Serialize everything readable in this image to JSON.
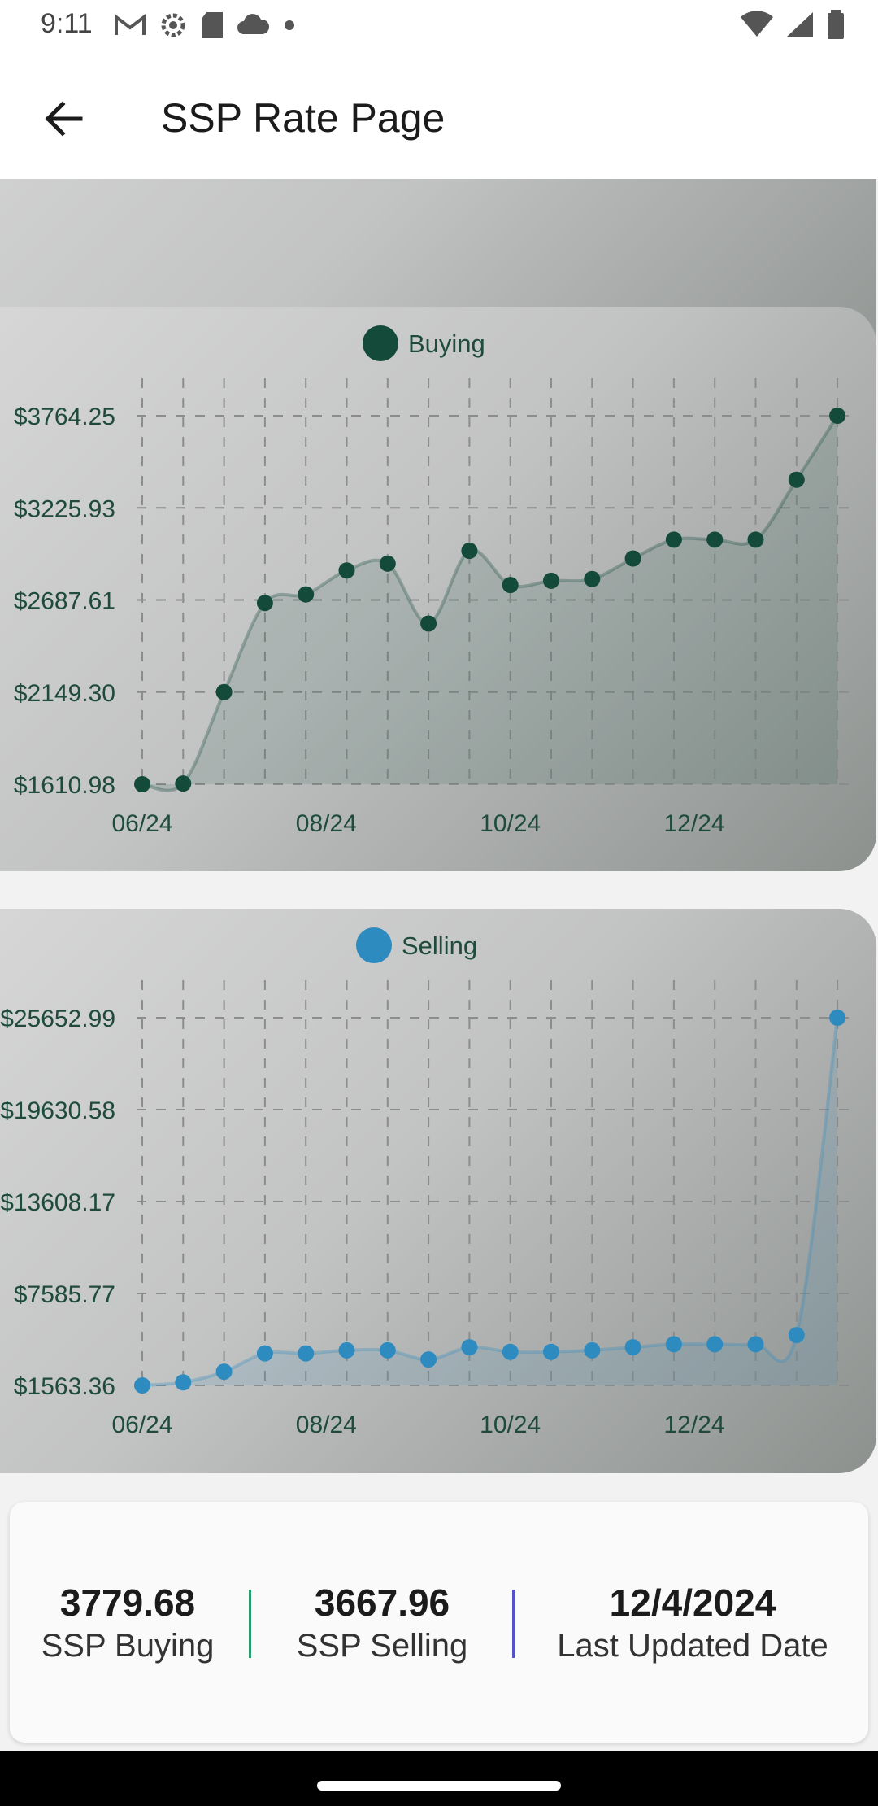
{
  "status_bar": {
    "time": "9:11",
    "left_icons": [
      "gmail-icon",
      "settings-icon",
      "sd-card-icon",
      "cloud-icon",
      "dot-icon"
    ],
    "right_icons": [
      "wifi-icon",
      "signal-icon",
      "battery-icon"
    ]
  },
  "app_bar": {
    "title": "SSP Rate Page",
    "back_icon": "arrow-left-icon"
  },
  "chart_data": [
    {
      "type": "line",
      "title": "",
      "partially_visible": true,
      "x_tick_labels": [
        "06/24",
        "08/24",
        "10/24",
        "12/24"
      ],
      "y_tick_labels_visible": [
        "$1563.36"
      ],
      "series": [
        {
          "values": [
            1563.36,
            1563.36,
            1563.36
          ],
          "color": "#2e8bc0"
        }
      ]
    },
    {
      "type": "line",
      "title": "",
      "series": [
        {
          "name": "Buying",
          "color": "#134a3a",
          "values": [
            1610.98,
            1615,
            2149.3,
            2670,
            2720,
            2860,
            2900,
            2550,
            2975,
            2775,
            2800,
            2810,
            2930,
            3040,
            3040,
            3040,
            3390,
            3764.25
          ]
        }
      ],
      "x_tick_labels": [
        "06/24",
        "08/24",
        "10/24",
        "12/24"
      ],
      "y_tick_labels": [
        "$1610.98",
        "$2149.30",
        "$2687.61",
        "$3225.93",
        "$3764.25"
      ],
      "ylim": [
        1610.98,
        3764.25
      ],
      "grid": true,
      "legend": "top-center"
    },
    {
      "type": "line",
      "title": "",
      "series": [
        {
          "name": "Selling",
          "color": "#2e8bc0",
          "values": [
            1563.36,
            1763.36,
            2463.36,
            3663.36,
            3663.36,
            3863.36,
            3863.36,
            3263.36,
            4063.36,
            3763.36,
            3763.36,
            3863.36,
            4063.36,
            4263.36,
            4263.36,
            4263.36,
            4863.36,
            25652.99
          ]
        }
      ],
      "x_tick_labels": [
        "06/24",
        "08/24",
        "10/24",
        "12/24"
      ],
      "y_tick_labels": [
        "$1563.36",
        "$7585.77",
        "$13608.17",
        "$19630.58",
        "$25652.99"
      ],
      "ylim": [
        1563.36,
        25652.99
      ],
      "grid": true,
      "legend": "top-center"
    }
  ],
  "summary": {
    "buying_value": "3779.68",
    "buying_label": "SSP Buying",
    "selling_value": "3667.96",
    "selling_label": "SSP Selling",
    "date_value": "12/4/2024",
    "date_label": "Last Updated Date",
    "divider_colors": [
      "#2a9d6f",
      "#5454c8"
    ]
  }
}
